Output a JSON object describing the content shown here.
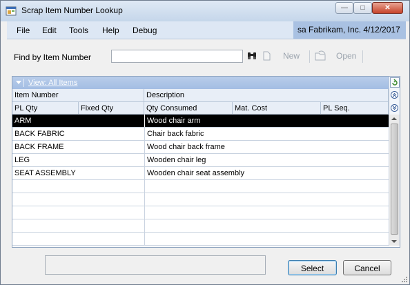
{
  "window": {
    "title": "Scrap Item Number Lookup"
  },
  "titlebar": {
    "minimize_icon": "minimize-icon",
    "maximize_icon": "maximize-icon",
    "close_icon": "close-icon"
  },
  "menu": {
    "items": [
      "File",
      "Edit",
      "Tools",
      "Help",
      "Debug"
    ]
  },
  "user_info": "sa  Fabrikam, Inc.  4/12/2017",
  "find": {
    "label": "Find by Item Number",
    "value": ""
  },
  "toolbar": {
    "new_label": "New",
    "open_label": "Open"
  },
  "view": {
    "label": "View: All Items"
  },
  "columns": {
    "row1": [
      "Item Number",
      "Description"
    ],
    "row2": [
      "PL Qty",
      "Fixed Qty",
      "Qty Consumed",
      "Mat. Cost",
      "PL Seq."
    ]
  },
  "rows": [
    {
      "item": "ARM",
      "description": "Wood chair arm",
      "selected": true
    },
    {
      "item": "BACK FABRIC",
      "description": "Chair back fabric",
      "selected": false
    },
    {
      "item": "BACK FRAME",
      "description": "Wood chair back frame",
      "selected": false
    },
    {
      "item": "LEG",
      "description": "Wooden chair leg",
      "selected": false
    },
    {
      "item": "SEAT ASSEMBLY",
      "description": "Wooden chair seat assembly",
      "selected": false
    }
  ],
  "empty_rows": 5,
  "buttons": {
    "select_label": "Select",
    "cancel_label": "Cancel"
  },
  "colors": {
    "selection": "#000000",
    "view_bar": "#a9c1e2",
    "header": "#e8eef7"
  }
}
